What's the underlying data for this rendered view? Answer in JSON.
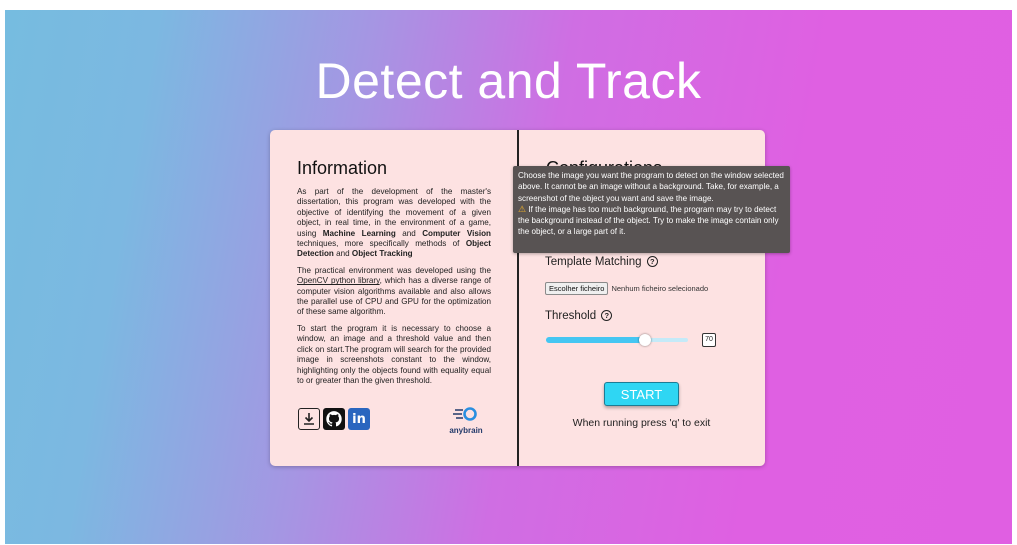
{
  "page": {
    "title": "Detect and Track"
  },
  "info": {
    "heading": "Information",
    "p1": [
      {
        "t": "As part of the development of the master's dissertation, this program was developed with the objective of identifying the movement of a given object, in real time, in the environment of a game, using "
      },
      {
        "t": "Machine Learning",
        "b": true
      },
      {
        "t": " and "
      },
      {
        "t": "Computer Vision",
        "b": true
      },
      {
        "t": " techniques, more specifically methods of "
      },
      {
        "t": "Object Detection",
        "b": true
      },
      {
        "t": " and "
      },
      {
        "t": "Object Tracking",
        "b": true
      }
    ],
    "p2": [
      {
        "t": "The practical environment was developed using the "
      },
      {
        "t": "OpenCV python library",
        "u": true
      },
      {
        "t": ", which has a diverse range of computer vision algorithms available and also allows the parallel use of CPU and GPU for the optimization of these same algorithm."
      }
    ],
    "p3": "To start the program it is necessary to choose a window, an image and a threshold value and then click on start.The program will search for the provided image in screenshots constant to the window, highlighting only the objects found with equality equal to or greater than the given threshold.",
    "icons": [
      "download-icon",
      "github-icon",
      "linkedin-icon"
    ],
    "linkedin_glyph": "in",
    "logo_text": "anybrain"
  },
  "config": {
    "heading": "Configurations",
    "template_label": "Template Matching",
    "help_glyph": "?",
    "file_button": "Escolher ficheiro",
    "file_status": "Nenhum ficheiro selecionado",
    "threshold_label": "Threshold",
    "threshold_value": "70",
    "threshold_fraction": 0.7,
    "start_label": "START",
    "exit_note": "When running press 'q' to exit"
  },
  "tooltip": {
    "line1": "Choose the image you want the program to detect on the window selected above. It cannot be an image without a background. Take, for example, a screenshot of the object you want and save the image.",
    "warn_icon": "warning-icon",
    "warn_glyph": "⚠",
    "line2": " If the image has too much background, the program may try to detect the background instead of the object. Try to make the image contain only the object, or a large part of it."
  },
  "colors": {
    "gradient_start": "#76bce0",
    "gradient_end": "#e05fe2",
    "card_bg": "#fde2e2",
    "start_button": "#2fd6f3",
    "slider_fill": "#45c6f2",
    "tooltip_bg": "#585353",
    "linkedin": "#2a66bf"
  }
}
